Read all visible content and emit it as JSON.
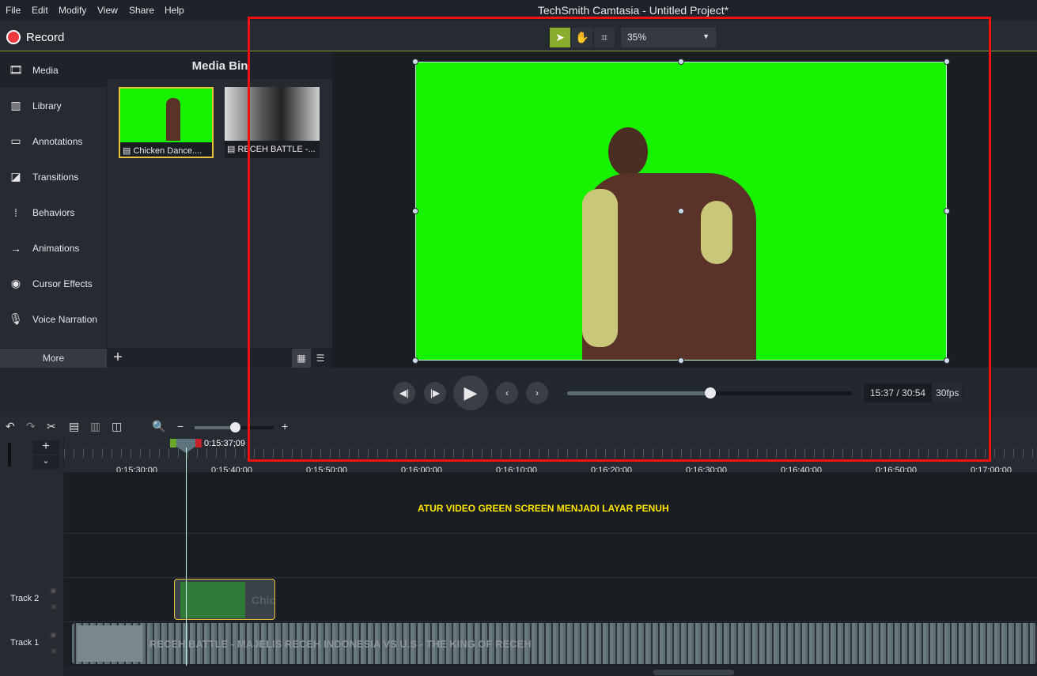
{
  "menu": [
    "File",
    "Edit",
    "Modify",
    "View",
    "Share",
    "Help"
  ],
  "window_title": "TechSmith Camtasia - Untitled Project*",
  "record_label": "Record",
  "canvas_toolbar": {
    "tools": [
      "select-arrow-icon",
      "pan-hand-icon",
      "crop-icon"
    ],
    "zoom": "35%"
  },
  "sidebar": {
    "items": [
      {
        "label": "Media",
        "icon": "film-icon"
      },
      {
        "label": "Library",
        "icon": "books-icon"
      },
      {
        "label": "Annotations",
        "icon": "annotation-icon"
      },
      {
        "label": "Transitions",
        "icon": "transition-icon"
      },
      {
        "label": "Behaviors",
        "icon": "behaviors-icon"
      },
      {
        "label": "Animations",
        "icon": "animation-arrow-icon"
      },
      {
        "label": "Cursor Effects",
        "icon": "cursor-icon"
      },
      {
        "label": "Voice Narration",
        "icon": "microphone-icon"
      }
    ],
    "more": "More"
  },
  "media_bin": {
    "title": "Media Bin",
    "items": [
      {
        "label": "Chicken Dance...."
      },
      {
        "label": "RECEH BATTLE -..."
      }
    ]
  },
  "player": {
    "time": "15:37 / 30:54",
    "fps": "30fps",
    "progress_percent": 50.4
  },
  "timeline": {
    "playhead_time": "0:15:37;09",
    "zoom_percent": 51,
    "ticks": [
      "0:15:30;00",
      "0:15:40;00",
      "0:15:50;00",
      "0:16:00;00",
      "0:16:10;00",
      "0:16:20;00",
      "0:16:30;00",
      "0:16:40;00",
      "0:16:50;00",
      "0:17:00;00"
    ],
    "overlay_text": "ATUR VIDEO GREEN SCREEN MENJADI LAYAR PENUH",
    "tracks": [
      {
        "name": "Track 2",
        "clip": "Chic"
      },
      {
        "name": "Track 1",
        "clip": "RECEH BATTLE - MAJELIS RECEH INDONESIA VS U.S - THE KING OF RECEH"
      }
    ]
  },
  "colors": {
    "accent": "#8aad2d",
    "record": "#f0393f",
    "selection": "#e8c23c",
    "annotation_box": "#ee1111",
    "green_screen": "#16f200"
  }
}
